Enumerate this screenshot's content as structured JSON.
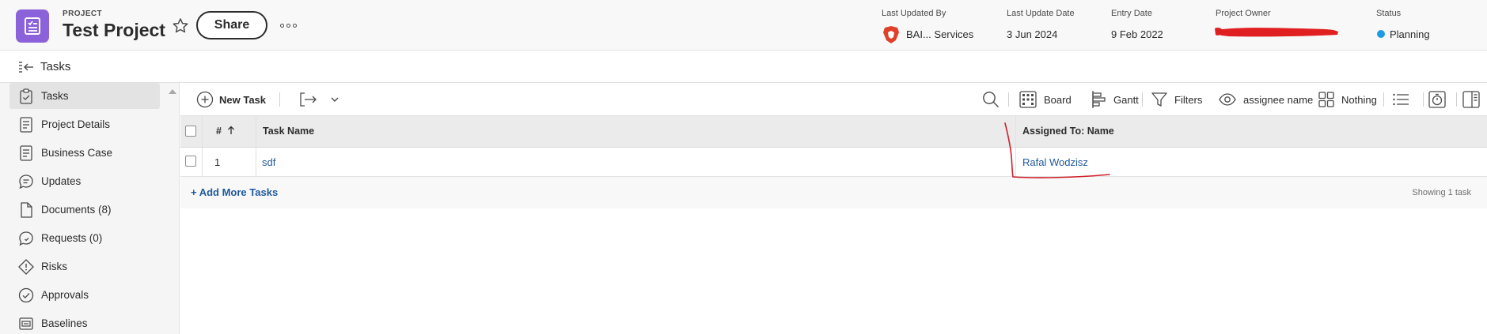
{
  "header": {
    "kicker": "PROJECT",
    "title": "Test Project",
    "share_label": "Share",
    "meta": {
      "last_updated_by_label": "Last Updated By",
      "last_updated_by_value": "BAI... Services",
      "last_update_date_label": "Last Update Date",
      "last_update_date_value": "3 Jun 2024",
      "entry_date_label": "Entry Date",
      "entry_date_value": "9 Feb 2022",
      "project_owner_label": "Project Owner",
      "status_label": "Status",
      "status_value": "Planning"
    },
    "icons": [
      "project-icon",
      "star-icon",
      "more-icon",
      "brave-lion-icon"
    ],
    "colors": {
      "project_icon_bg": "#8b62d9",
      "status_dot": "#1e9be6",
      "redaction": "#e02020"
    }
  },
  "breadcrumb": {
    "title": "Tasks"
  },
  "sidebar": {
    "items": [
      {
        "label": "Tasks",
        "icon": "clipboard-check-icon",
        "active": true
      },
      {
        "label": "Project Details",
        "icon": "document-lines-icon",
        "active": false
      },
      {
        "label": "Business Case",
        "icon": "document-lines-icon",
        "active": false
      },
      {
        "label": "Updates",
        "icon": "chat-bubble-icon",
        "active": false
      },
      {
        "label": "Documents (8)",
        "icon": "file-icon",
        "active": false
      },
      {
        "label": "Requests (0)",
        "icon": "request-bubble-icon",
        "active": false
      },
      {
        "label": "Risks",
        "icon": "diamond-warning-icon",
        "active": false
      },
      {
        "label": "Approvals",
        "icon": "check-circle-icon",
        "active": false
      },
      {
        "label": "Baselines",
        "icon": "baseline-calendar-icon",
        "active": false
      }
    ]
  },
  "toolbar": {
    "new_task_label": "New Task",
    "board_label": "Board",
    "gantt_label": "Gantt",
    "filters_label": "Filters",
    "view_label": "assignee name",
    "grouping_label": "Nothing"
  },
  "grid": {
    "columns": {
      "number": "#",
      "task_name": "Task Name",
      "assigned_to": "Assigned To: Name"
    },
    "rows": [
      {
        "number": "1",
        "task_name": "sdf",
        "assigned_to": "Rafal Wodzisz"
      }
    ],
    "add_more_label": "+ Add More Tasks",
    "showing_label": "Showing 1 task",
    "colors": {
      "link": "#1e5a9e",
      "annotation": "#d0202a"
    }
  }
}
